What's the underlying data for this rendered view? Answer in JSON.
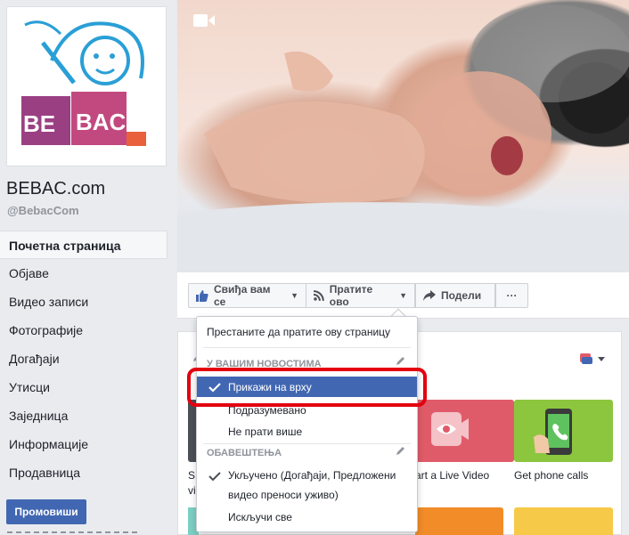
{
  "page": {
    "name": "BEBAC.com",
    "handle": "@BebacCom",
    "logo_text": "BE BAC"
  },
  "sidebar": {
    "items": [
      {
        "label": "Почетна страница",
        "active": true
      },
      {
        "label": "Објаве"
      },
      {
        "label": "Видео записи"
      },
      {
        "label": "Фотографије"
      },
      {
        "label": "Догађаји"
      },
      {
        "label": "Утисци"
      },
      {
        "label": "Заједница"
      },
      {
        "label": "Информације"
      },
      {
        "label": "Продавница"
      }
    ],
    "promote_label": "Промовиши"
  },
  "actions": {
    "like_label": "Свиђа вам се",
    "follow_label": "Пратите ово",
    "share_label": "Подели",
    "more_label": "···"
  },
  "dropdown": {
    "unfollow_page": "Престаните да пратите ову страницу",
    "news_header": "У ВАШИМ НОВОСТИМА",
    "show_on_top": "Прикажи на врху",
    "default": "Подразумевано",
    "unfollow": "Не прати више",
    "notifications_header": "ОБАВЕШТЕЊА",
    "on_line1": "Укључено (Догађаји, Предложени",
    "on_line2": "видео преноси уживо)",
    "all_off": "Искључи све"
  },
  "card": {
    "tile_live_label": "art a Live Video",
    "tile_phone_label": "Get phone calls",
    "left_label_1": "S",
    "left_label_2": "vi"
  },
  "colors": {
    "brand_blue": "#4267b2",
    "highlight_red": "#e3000f",
    "tile_live": "#e05b69",
    "tile_phone": "#8cc63f"
  }
}
